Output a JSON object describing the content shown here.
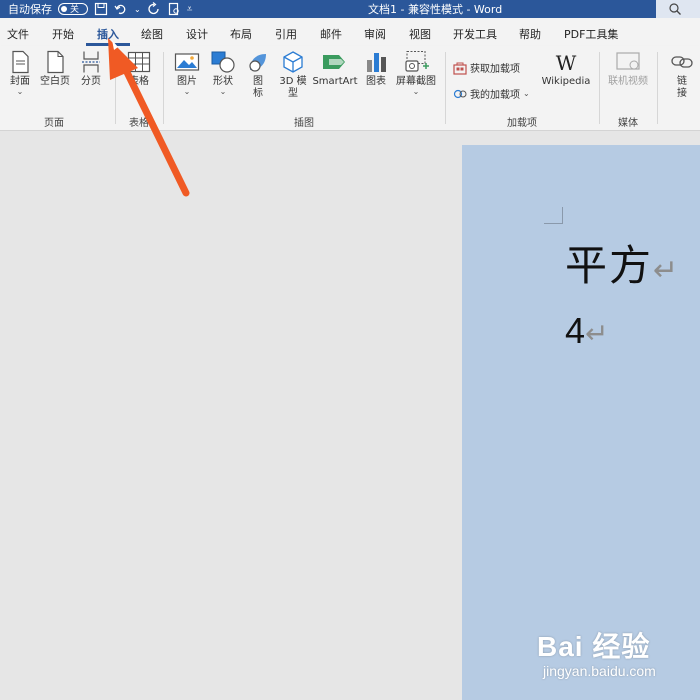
{
  "titlebar": {
    "autosave_label": "自动保存",
    "autosave_state": "关",
    "doc_title": "文档1 - 兼容性模式 - Word"
  },
  "tabs": [
    {
      "label": "文件"
    },
    {
      "label": "开始"
    },
    {
      "label": "插入",
      "active": true
    },
    {
      "label": "绘图"
    },
    {
      "label": "设计"
    },
    {
      "label": "布局"
    },
    {
      "label": "引用"
    },
    {
      "label": "邮件"
    },
    {
      "label": "审阅"
    },
    {
      "label": "视图"
    },
    {
      "label": "开发工具"
    },
    {
      "label": "帮助"
    },
    {
      "label": "PDF工具集"
    }
  ],
  "ribbon": {
    "pages": {
      "cover": "封面",
      "blank": "空白页",
      "break": "分页",
      "group": "页面"
    },
    "tables": {
      "table": "表格",
      "group": "表格"
    },
    "illustrations": {
      "picture": "图片",
      "shape": "形状",
      "icon_line1": "图",
      "icon_line2": "标",
      "model_line1": "3D 模",
      "model_line2": "型",
      "smartart": "SmartArt",
      "chart": "图表",
      "screenshot": "屏幕截图",
      "group": "插图"
    },
    "addins": {
      "get": "获取加载项",
      "mine": "我的加载项",
      "wikipedia": "Wikipedia",
      "wiki_logo": "W",
      "group": "加载项"
    },
    "media": {
      "video": "联机视频",
      "group": "媒体"
    },
    "links": {
      "link_line1": "链",
      "link_line2": "接"
    }
  },
  "document": {
    "line1": "平方",
    "line2": "4",
    "return_mark": "↵"
  },
  "watermark": {
    "main": "Bai 经验",
    "sub": "jingyan.baidu.com"
  },
  "colors": {
    "titlebar": "#2b579a",
    "ribbon": "#f3f3f3",
    "page": "#b6cbe3",
    "arrow": "#f05a24"
  }
}
